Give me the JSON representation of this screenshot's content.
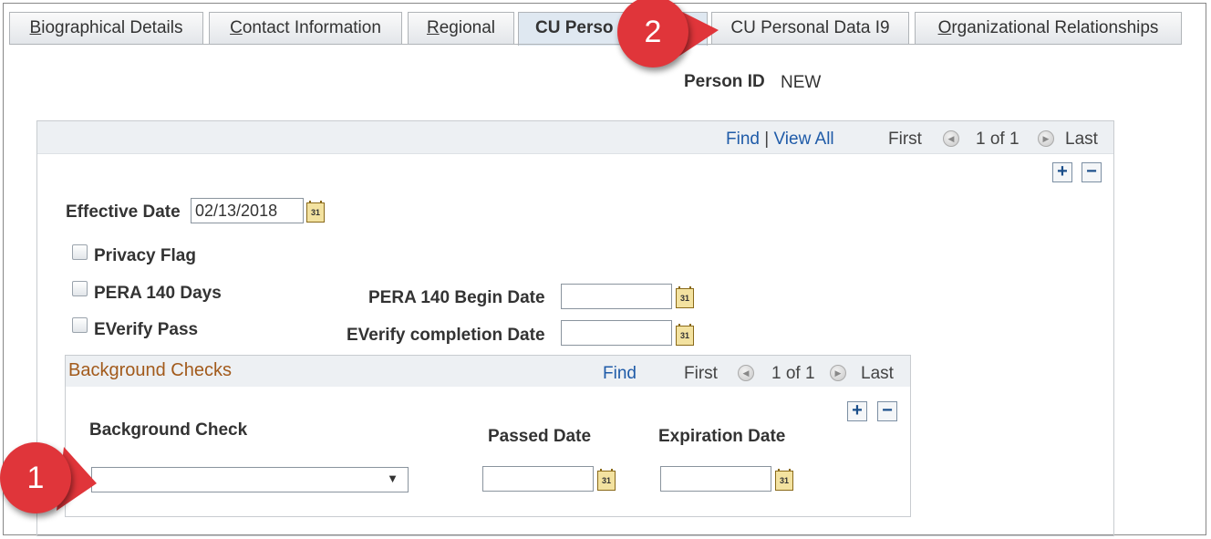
{
  "tabs": [
    {
      "label": "Biographical Details",
      "ul": "B",
      "rest": "iographical Details"
    },
    {
      "label": "Contact Information",
      "ul": "C",
      "rest": "ontact Information"
    },
    {
      "label": "Regional",
      "ul": "R",
      "rest": "egional"
    },
    {
      "label": "CU Perso",
      "active": true
    },
    {
      "label": "CU Personal Data I9"
    },
    {
      "label": "Organizational Relationships",
      "ul": "O",
      "rest": "rganizational Relationships"
    }
  ],
  "person_id": {
    "label": "Person ID",
    "value": "NEW"
  },
  "outer_nav": {
    "find": "Find",
    "sep": "|",
    "view_all": "View All",
    "first": "First",
    "count": "1 of 1",
    "last": "Last"
  },
  "effective_date": {
    "label": "Effective Date",
    "value": "02/13/2018"
  },
  "checkboxes": {
    "privacy": "Privacy Flag",
    "pera": "PERA 140 Days",
    "everify": "EVerify Pass"
  },
  "dates": {
    "pera_begin": "PERA 140 Begin Date",
    "everify_completion": "EVerify completion Date"
  },
  "background": {
    "title": "Background Checks",
    "find": "Find",
    "first": "First",
    "count": "1 of 1",
    "last": "Last",
    "col_check": "Background Check",
    "col_passed": "Passed Date",
    "col_expiration": "Expiration Date"
  },
  "buttons": {
    "add": "+",
    "remove": "−"
  },
  "callouts": {
    "one": "1",
    "two": "2"
  },
  "icons": {
    "calendar": "31",
    "dropdown": "▼",
    "prev": "◀",
    "next": "▶"
  },
  "colors": {
    "callout": "#e0353a",
    "section_title": "#a25a1b",
    "link": "#1f5ba8"
  }
}
